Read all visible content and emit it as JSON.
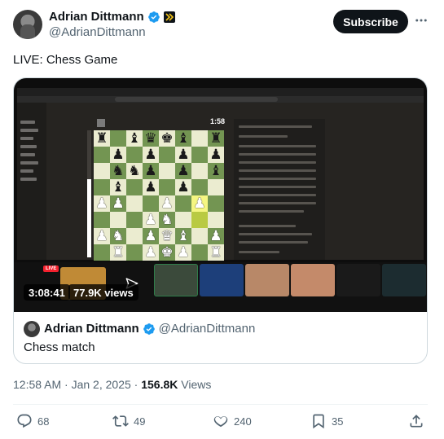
{
  "author": {
    "name": "Adrian Dittmann",
    "handle": "@AdrianDittmann",
    "verified_icon": "verified-badge-icon",
    "affiliate_icon": "affiliate-badge-icon"
  },
  "header": {
    "subscribe_label": "Subscribe",
    "more_icon": "more-icon"
  },
  "tweet": {
    "text": "LIVE: Chess Game"
  },
  "video": {
    "live_label": "LIVE",
    "duration": "3:08:41",
    "views": "77.9K views",
    "clock": "1:58"
  },
  "quote": {
    "name": "Adrian Dittmann",
    "handle": "@AdrianDittmann",
    "text": "Chess match"
  },
  "meta": {
    "time": "12:58 AM · Jan 2, 2025 · ",
    "views_count": "156.8K",
    "views_label": " Views"
  },
  "actions": {
    "replies": "68",
    "reposts": "49",
    "likes": "240"
  },
  "colors": {
    "brand_text": "#0f1419",
    "secondary_text": "#536471",
    "verified": "#1d9bf0",
    "board_light": "#ebecd0",
    "board_dark": "#739552"
  }
}
